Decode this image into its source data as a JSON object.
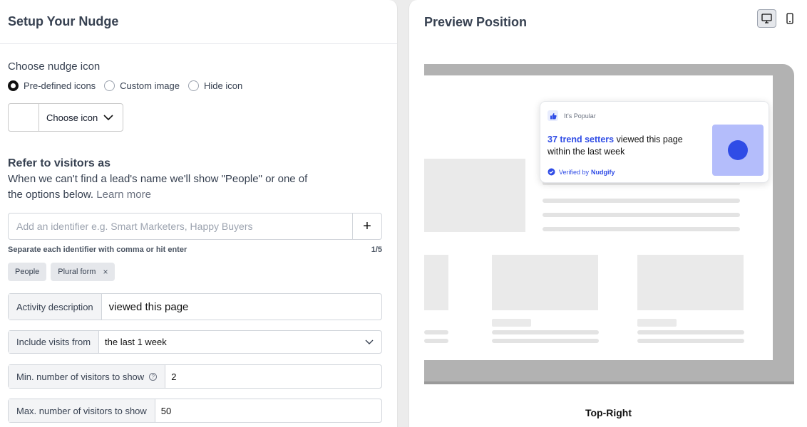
{
  "setup": {
    "title": "Setup Your Nudge",
    "icon_section": {
      "label": "Choose nudge icon",
      "options": [
        "Pre-defined icons",
        "Custom image",
        "Hide icon"
      ],
      "selected": "Pre-defined icons",
      "choose_label": "Choose icon"
    },
    "visitors": {
      "title": "Refer to visitors as",
      "description": "When we can't find a lead's name we'll show \"People\" or one of the options below.",
      "learn_more": "Learn more",
      "placeholder": "Add an identifier e.g. Smart Marketers, Happy Buyers",
      "add_label": "+",
      "hint": "Separate each identifier with comma or hit enter",
      "count": "1/5",
      "tags": [
        "People",
        "Plural form"
      ]
    },
    "activity": {
      "label": "Activity description",
      "value": "viewed this page"
    },
    "visits": {
      "label": "Include visits from",
      "value": "the last 1 week"
    },
    "min_visitors": {
      "label": "Min. number of visitors to show",
      "value": "2"
    },
    "max_visitors": {
      "label": "Max. number of visitors to show",
      "value": "50"
    }
  },
  "preview": {
    "title": "Preview Position",
    "nudge": {
      "badge": "It's Popular",
      "highlight": "37 trend setters",
      "message_rest": " viewed this page within the last week",
      "verified_prefix": "Verified by",
      "verified_brand": "Nudgify"
    },
    "position_label": "Top-Right"
  },
  "colors": {
    "accent": "#2f4ce6",
    "nudge_image_bg": "#b4bdfb"
  },
  "icons": [
    "chevron-down-icon",
    "plus-icon",
    "close-icon",
    "help-icon",
    "desktop-icon",
    "mobile-icon",
    "thumbs-up-icon",
    "check-badge-icon"
  ]
}
